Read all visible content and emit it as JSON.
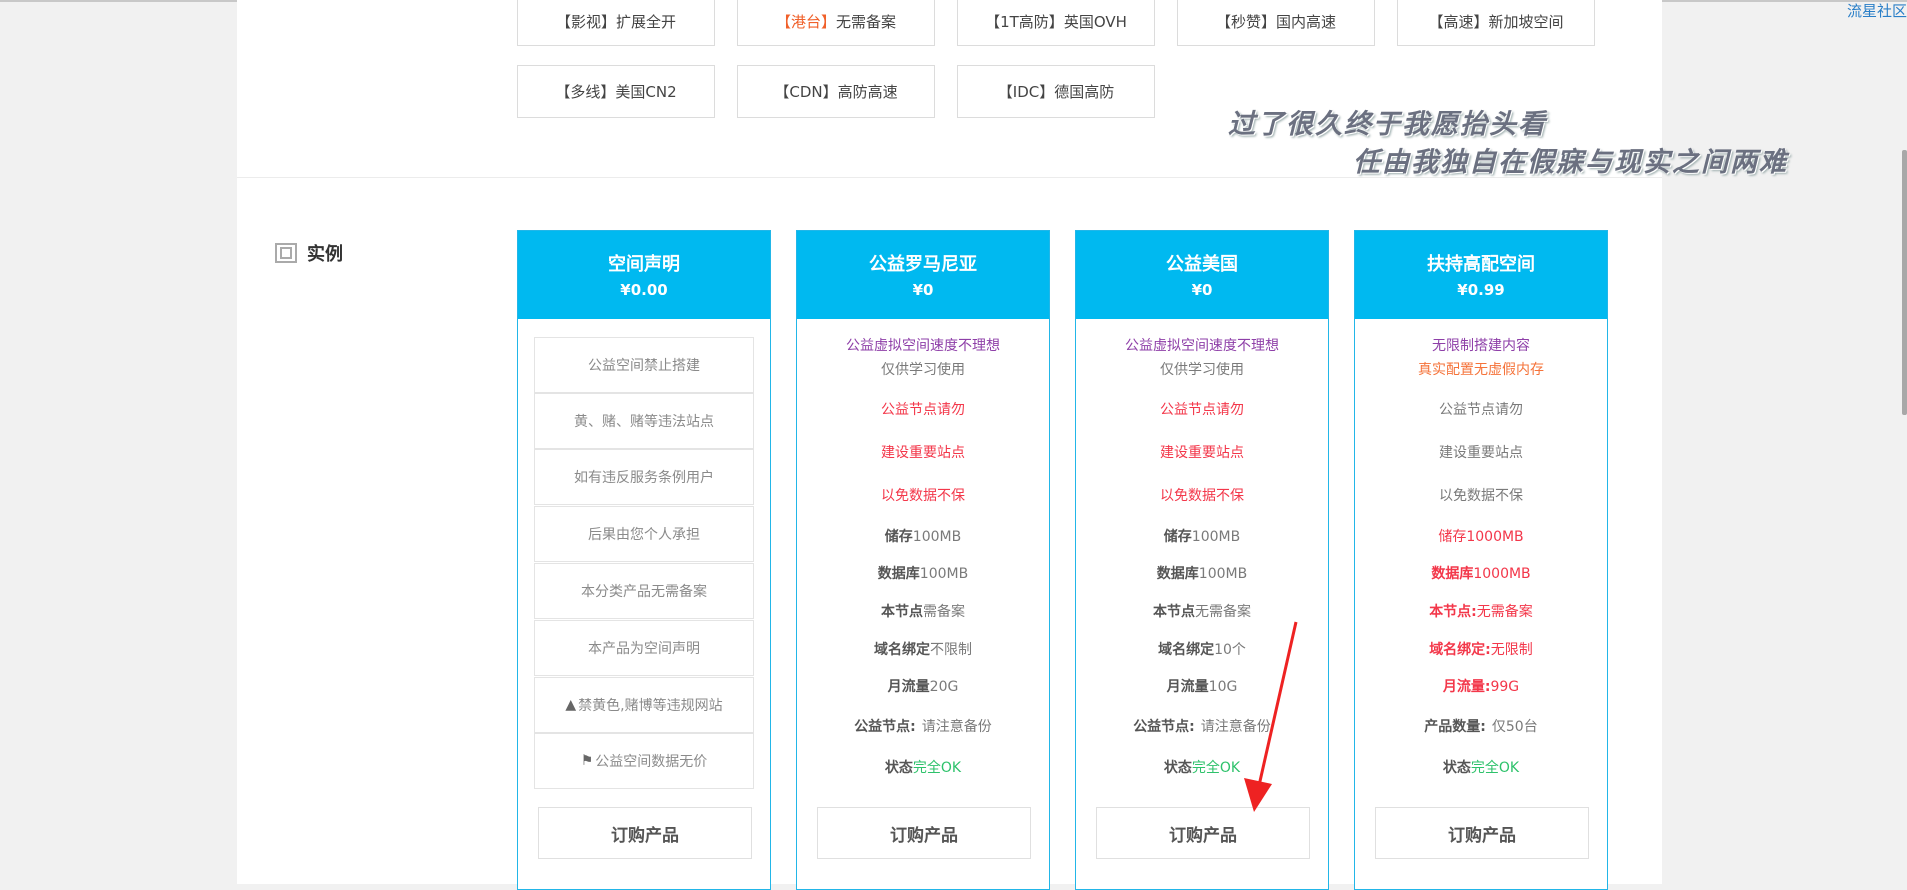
{
  "top_tags": [
    {
      "bracket": "【影视】",
      "label": "扩展全开",
      "hot": false
    },
    {
      "bracket": "【港台】",
      "label": "无需备案",
      "hot": true
    },
    {
      "bracket": "【1T高防】",
      "label": "英国OVH",
      "hot": false
    },
    {
      "bracket": "【秒赞】",
      "label": "国内高速",
      "hot": false
    },
    {
      "bracket": "【高速】",
      "label": "新加坡空间",
      "hot": false
    },
    {
      "bracket": "【多线】",
      "label": "美国CN2",
      "hot": false
    },
    {
      "bracket": "【CDN】",
      "label": "高防高速",
      "hot": false
    },
    {
      "bracket": "【IDC】",
      "label": "德国高防",
      "hot": false
    }
  ],
  "section": {
    "label": "实例",
    "icon": "frame-icon"
  },
  "banner": {
    "line1": "过了很久终于我愿抬头看",
    "line2": "任由我独自在假寐与现实之间两难"
  },
  "corner_link": "流星社区",
  "cards": [
    {
      "title": "空间声明",
      "price": "¥0.00",
      "items": [
        "公益空间禁止搭建",
        "黄、赌、赌等违法站点",
        "如有违反服务条例用户",
        "后果由您个人承担",
        "本分类产品无需备案",
        "本产品为空间声明",
        "禁黄色,赌博等违规网站",
        "公益空间数据无价"
      ],
      "button": "订购产品"
    },
    {
      "title": "公益罗马尼亚",
      "price": "¥0",
      "intro1": "公益虚拟空间速度不理想",
      "intro2": "仅供学习使用",
      "notes": [
        "公益节点请勿",
        "建设重要站点",
        "以免数据不保"
      ],
      "specs": [
        {
          "k": "储存",
          "v": "100MB"
        },
        {
          "k": "数据库",
          "v": "100MB"
        },
        {
          "k": "本节点",
          "v": "需备案"
        },
        {
          "k": "域名绑定",
          "v": "不限制"
        },
        {
          "k": "月流量",
          "v": "20G"
        },
        {
          "k": "公益节点:",
          "v": "请注意备份"
        },
        {
          "k": "状态",
          "v": "完全OK"
        }
      ],
      "button": "订购产品"
    },
    {
      "title": "公益美国",
      "price": "¥0",
      "intro1": "公益虚拟空间速度不理想",
      "intro2": "仅供学习使用",
      "notes": [
        "公益节点请勿",
        "建设重要站点",
        "以免数据不保"
      ],
      "specs": [
        {
          "k": "储存",
          "v": "100MB"
        },
        {
          "k": "数据库",
          "v": "100MB"
        },
        {
          "k": "本节点",
          "v": "无需备案"
        },
        {
          "k": "域名绑定",
          "v": "10个"
        },
        {
          "k": "月流量",
          "v": "10G"
        },
        {
          "k": "公益节点:",
          "v": "请注意备份"
        },
        {
          "k": "状态",
          "v": "完全OK"
        }
      ],
      "button": "订购产品"
    },
    {
      "title": "扶持高配空间",
      "price": "¥0.99",
      "intro1": "无限制搭建内容",
      "intro2": "真实配置无虚假内存",
      "notes": [
        "公益节点请勿",
        "建设重要站点",
        "以免数据不保"
      ],
      "specs": [
        {
          "k": "储存",
          "v": "1000MB"
        },
        {
          "k": "数据库",
          "v": "1000MB"
        },
        {
          "k": "本节点:",
          "v": "无需备案"
        },
        {
          "k": "域名绑定:",
          "v": "无限制"
        },
        {
          "k": "月流量:",
          "v": "99G"
        },
        {
          "k": "产品数量:",
          "v": "仅50台"
        },
        {
          "k": "状态",
          "v": "完全OK"
        }
      ],
      "button": "订购产品"
    }
  ]
}
